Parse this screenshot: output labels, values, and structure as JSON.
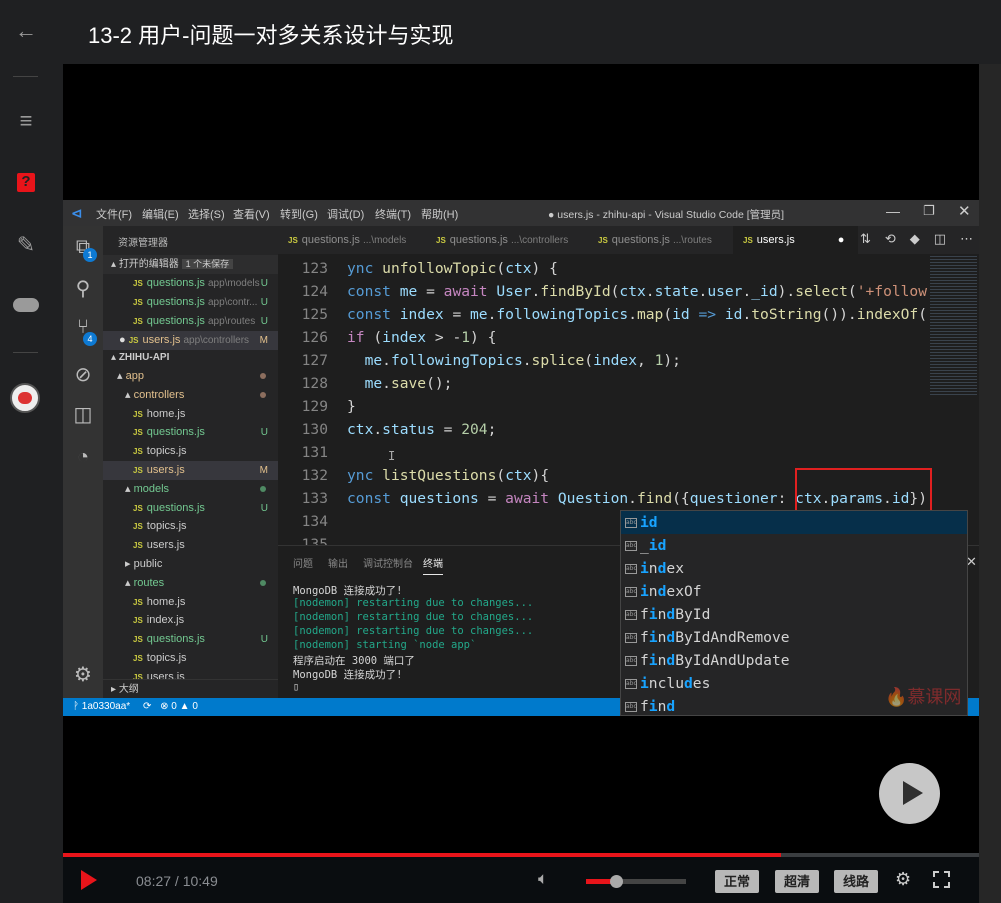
{
  "page": {
    "title": "13-2 用户-问题一对多关系设计与实现"
  },
  "nav": [
    {
      "icon": "back-arrow-icon"
    },
    {
      "icon": "menu-icon"
    },
    {
      "icon": "question-icon"
    },
    {
      "icon": "edit-icon"
    },
    {
      "icon": "cloud-check-icon"
    },
    {
      "icon": "avatar"
    }
  ],
  "vscode": {
    "window_title": "● users.js - zhihu-api - Visual Studio Code [管理员]",
    "menu": [
      "文件(F)",
      "编辑(E)",
      "选择(S)",
      "查看(V)",
      "转到(G)",
      "调试(D)",
      "终端(T)",
      "帮助(H)"
    ],
    "activity_badges": {
      "explorer": "1",
      "scm": "4"
    },
    "explorer_title": "资源管理器",
    "open_editors": {
      "label": "打开的编辑器",
      "badge": "1 个未保存",
      "items": [
        {
          "name": "questions.js",
          "path": "app\\models",
          "flag": "U"
        },
        {
          "name": "questions.js",
          "path": "app\\contr...",
          "flag": "U"
        },
        {
          "name": "questions.js",
          "path": "app\\routes",
          "flag": "U"
        },
        {
          "name": "users.js",
          "path": "app\\controllers",
          "flag": "M"
        }
      ]
    },
    "project": "ZHIHU-API",
    "tree": [
      {
        "label": "app",
        "depth": 0,
        "folder": true,
        "open": true,
        "color": "orange",
        "dot": "#8c6e5e"
      },
      {
        "label": "controllers",
        "depth": 1,
        "folder": true,
        "open": true,
        "color": "orange",
        "dot": "#8c6e5e"
      },
      {
        "label": "home.js",
        "depth": 2
      },
      {
        "label": "questions.js",
        "depth": 2,
        "color": "green",
        "flag": "U"
      },
      {
        "label": "topics.js",
        "depth": 2
      },
      {
        "label": "users.js",
        "depth": 2,
        "color": "orange",
        "flag": "M",
        "selected": true
      },
      {
        "label": "models",
        "depth": 1,
        "folder": true,
        "open": true,
        "color": "green",
        "dot": "#4f8a63"
      },
      {
        "label": "questions.js",
        "depth": 2,
        "color": "green",
        "flag": "U"
      },
      {
        "label": "topics.js",
        "depth": 2
      },
      {
        "label": "users.js",
        "depth": 2
      },
      {
        "label": "public",
        "depth": 1,
        "folder": true,
        "open": false
      },
      {
        "label": "routes",
        "depth": 1,
        "folder": true,
        "open": true,
        "color": "green",
        "dot": "#4f8a63"
      },
      {
        "label": "home.js",
        "depth": 2
      },
      {
        "label": "index.js",
        "depth": 2
      },
      {
        "label": "questions.js",
        "depth": 2,
        "color": "green",
        "flag": "U"
      },
      {
        "label": "topics.js",
        "depth": 2
      },
      {
        "label": "users.js",
        "depth": 2
      }
    ],
    "outline": "大纲",
    "tabs": [
      {
        "name": "questions.js",
        "path": "...\\models"
      },
      {
        "name": "questions.js",
        "path": "...\\controllers"
      },
      {
        "name": "questions.js",
        "path": "...\\routes"
      },
      {
        "name": "users.js",
        "path": "",
        "active": true,
        "dirty": true
      }
    ],
    "code": [
      {
        "n": "123",
        "t": [
          [
            "k",
            "ync "
          ],
          [
            "f",
            "unfollowTopic"
          ],
          [
            "",
            "("
          ],
          [
            "v",
            "ctx"
          ],
          [
            "",
            ") {"
          ]
        ]
      },
      {
        "n": "124",
        "t": [
          [
            "k",
            "const "
          ],
          [
            "v",
            "me"
          ],
          [
            "",
            " = "
          ],
          [
            "p",
            "await "
          ],
          [
            "v",
            "User"
          ],
          [
            "",
            "."
          ],
          [
            "f",
            "findById"
          ],
          [
            "",
            "("
          ],
          [
            "v",
            "ctx"
          ],
          [
            "",
            "."
          ],
          [
            "v",
            "state"
          ],
          [
            "",
            "."
          ],
          [
            "v",
            "user"
          ],
          [
            "",
            "."
          ],
          [
            "v",
            "_id"
          ],
          [
            "",
            ")."
          ],
          [
            "f",
            "select"
          ],
          [
            "",
            "("
          ],
          [
            "s",
            "'+follow"
          ]
        ]
      },
      {
        "n": "125",
        "t": [
          [
            "k",
            "const "
          ],
          [
            "v",
            "index"
          ],
          [
            "",
            " = "
          ],
          [
            "v",
            "me"
          ],
          [
            "",
            "."
          ],
          [
            "v",
            "followingTopics"
          ],
          [
            "",
            "."
          ],
          [
            "f",
            "map"
          ],
          [
            "",
            "("
          ],
          [
            "v",
            "id"
          ],
          [
            "k",
            " => "
          ],
          [
            "v",
            "id"
          ],
          [
            "",
            "."
          ],
          [
            "f",
            "toString"
          ],
          [
            "",
            "())."
          ],
          [
            "f",
            "indexOf"
          ],
          [
            "",
            "("
          ]
        ]
      },
      {
        "n": "126",
        "t": [
          [
            "p",
            "if "
          ],
          [
            "",
            "("
          ],
          [
            "v",
            "index"
          ],
          [
            "",
            " > -"
          ],
          [
            "n",
            "1"
          ],
          [
            "",
            ") {"
          ]
        ]
      },
      {
        "n": "127",
        "t": [
          [
            "",
            "  "
          ],
          [
            "v",
            "me"
          ],
          [
            "",
            "."
          ],
          [
            "v",
            "followingTopics"
          ],
          [
            "",
            "."
          ],
          [
            "f",
            "splice"
          ],
          [
            "",
            "("
          ],
          [
            "v",
            "index"
          ],
          [
            "",
            ", "
          ],
          [
            "n",
            "1"
          ],
          [
            "",
            ");"
          ]
        ]
      },
      {
        "n": "128",
        "t": [
          [
            "",
            "  "
          ],
          [
            "v",
            "me"
          ],
          [
            "",
            "."
          ],
          [
            "f",
            "save"
          ],
          [
            "",
            "();"
          ]
        ]
      },
      {
        "n": "129",
        "t": [
          [
            "",
            "}"
          ]
        ]
      },
      {
        "n": "130",
        "t": [
          [
            "v",
            "ctx"
          ],
          [
            "",
            "."
          ],
          [
            "v",
            "status"
          ],
          [
            "",
            " = "
          ],
          [
            "n",
            "204"
          ],
          [
            "",
            ";"
          ]
        ]
      },
      {
        "n": "131",
        "t": []
      },
      {
        "n": "132",
        "t": [
          [
            "k",
            "ync "
          ],
          [
            "f",
            "listQuestions"
          ],
          [
            "",
            "("
          ],
          [
            "v",
            "ctx"
          ],
          [
            "",
            "){"
          ]
        ]
      },
      {
        "n": "133",
        "t": [
          [
            "k",
            "const "
          ],
          [
            "v",
            "questions"
          ],
          [
            "",
            " = "
          ],
          [
            "p",
            "await "
          ],
          [
            "v",
            "Question"
          ],
          [
            "",
            "."
          ],
          [
            "f",
            "find"
          ],
          [
            "",
            "({"
          ],
          [
            "v",
            "questioner"
          ],
          [
            "",
            ": "
          ],
          [
            "v",
            "ctx"
          ],
          [
            "",
            "."
          ],
          [
            "v",
            "params"
          ],
          [
            "",
            "."
          ],
          [
            "v",
            "id"
          ],
          [
            "",
            "});"
          ]
        ]
      },
      {
        "n": "134",
        "t": []
      },
      {
        "n": "135",
        "t": []
      }
    ],
    "panel_tabs": [
      "问题",
      "输出",
      "调试控制台",
      "终端"
    ],
    "terminal": [
      {
        "text": "MongoDB 连接成功了!",
        "color": "#d4d4d4"
      },
      {
        "text": "[nodemon] restarting due to changes...",
        "color": "#23a88a"
      },
      {
        "text": "[nodemon] restarting due to changes...",
        "color": "#23a88a"
      },
      {
        "text": "[nodemon] restarting due to changes...",
        "color": "#23a88a"
      },
      {
        "text": "[nodemon] starting `node app`",
        "color": "#23a88a"
      },
      {
        "text": "程序启动在 3000 端口了",
        "color": "#d4d4d4"
      },
      {
        "text": "MongoDB 连接成功了!",
        "color": "#d4d4d4"
      }
    ],
    "status": {
      "branch": "1a0330aa*",
      "errors": "0",
      "warnings": "0"
    },
    "suggestions": [
      {
        "label": "id",
        "hl": [
          0,
          1
        ],
        "selected": true
      },
      {
        "label": "_id",
        "hl": [
          1,
          2
        ]
      },
      {
        "label": "index",
        "hl": [
          0,
          2
        ]
      },
      {
        "label": "indexOf",
        "hl": [
          0,
          2
        ]
      },
      {
        "label": "findById",
        "hl": [
          1,
          3
        ]
      },
      {
        "label": "findByIdAndRemove",
        "hl": [
          1,
          3
        ]
      },
      {
        "label": "findByIdAndUpdate",
        "hl": [
          1,
          3
        ]
      },
      {
        "label": "includes",
        "hl": [
          0,
          5
        ]
      },
      {
        "label": "find",
        "hl": [
          1,
          3
        ]
      }
    ],
    "suggest_icon": "abc"
  },
  "watermark": "慕课网",
  "player": {
    "current_time": "08:27",
    "duration": "10:49",
    "time_sep": " / ",
    "progress_percent": 78.4,
    "volume_percent": 30,
    "buttons": [
      "正常",
      "超清",
      "线路"
    ]
  },
  "colors": {
    "accent": "#e8141a",
    "statusbar": "#007acc"
  }
}
